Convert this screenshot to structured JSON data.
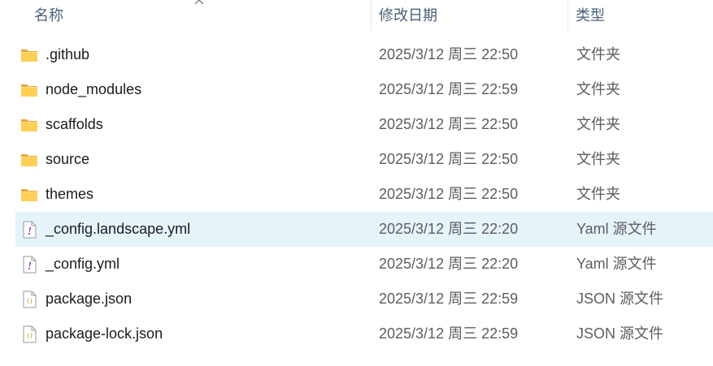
{
  "header": {
    "name_label": "名称",
    "date_label": "修改日期",
    "type_label": "类型",
    "sort_indicator": "chevron-up-icon"
  },
  "files": [
    {
      "name": ".github",
      "date": "2025/3/12 周三 22:50",
      "type": "文件夹",
      "icon": "folder-icon",
      "selected": false
    },
    {
      "name": "node_modules",
      "date": "2025/3/12 周三 22:59",
      "type": "文件夹",
      "icon": "folder-icon",
      "selected": false
    },
    {
      "name": "scaffolds",
      "date": "2025/3/12 周三 22:50",
      "type": "文件夹",
      "icon": "folder-icon",
      "selected": false
    },
    {
      "name": "source",
      "date": "2025/3/12 周三 22:50",
      "type": "文件夹",
      "icon": "folder-icon",
      "selected": false
    },
    {
      "name": "themes",
      "date": "2025/3/12 周三 22:50",
      "type": "文件夹",
      "icon": "folder-icon",
      "selected": false
    },
    {
      "name": "_config.landscape.yml",
      "date": "2025/3/12 周三 22:20",
      "type": "Yaml 源文件",
      "icon": "yaml-file-icon",
      "selected": true
    },
    {
      "name": "_config.yml",
      "date": "2025/3/12 周三 22:20",
      "type": "Yaml 源文件",
      "icon": "yaml-file-icon",
      "selected": false
    },
    {
      "name": "package.json",
      "date": "2025/3/12 周三 22:59",
      "type": "JSON 源文件",
      "icon": "json-file-icon",
      "selected": false
    },
    {
      "name": "package-lock.json",
      "date": "2025/3/12 周三 22:59",
      "type": "JSON 源文件",
      "icon": "json-file-icon",
      "selected": false
    }
  ],
  "colors": {
    "selected_row": "#e5f3fb",
    "folder_yellow": "#f8c94a",
    "header_text": "#4c607a"
  }
}
